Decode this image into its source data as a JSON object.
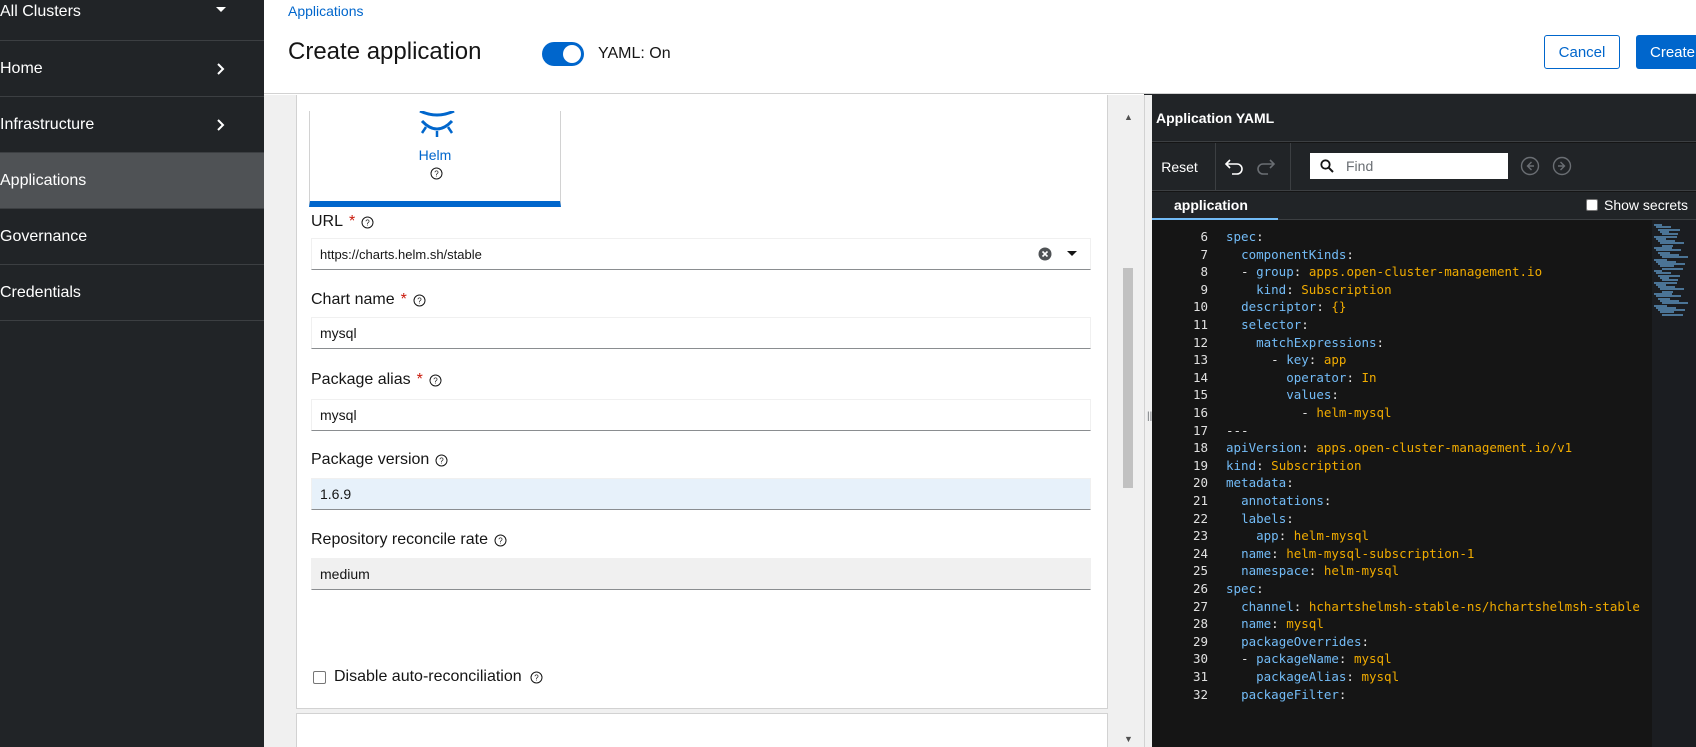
{
  "sidebar": {
    "items": [
      {
        "label": "All Clusters",
        "chevron": "down"
      },
      {
        "label": "Home",
        "chevron": "right"
      },
      {
        "label": "Infrastructure",
        "chevron": "right"
      },
      {
        "label": "Applications",
        "active": true
      },
      {
        "label": "Governance"
      },
      {
        "label": "Credentials"
      }
    ]
  },
  "header": {
    "breadcrumb": "Applications",
    "title": "Create application",
    "yaml_toggle_label": "YAML: On",
    "yaml_toggle_on": true,
    "cancel_label": "Cancel",
    "create_label": "Create"
  },
  "form": {
    "helm_tile_label": "Helm",
    "url": {
      "label": "URL",
      "required": "*",
      "value": "https://charts.helm.sh/stable"
    },
    "chart_name": {
      "label": "Chart name",
      "required": "*",
      "value": "mysql"
    },
    "package_alias": {
      "label": "Package alias",
      "required": "*",
      "value": "mysql"
    },
    "package_version": {
      "label": "Package version",
      "value": "1.6.9"
    },
    "reconcile_rate": {
      "label": "Repository reconcile rate",
      "value": "medium"
    },
    "disable_reconcile": {
      "label": "Disable auto-reconciliation",
      "checked": false
    }
  },
  "yaml": {
    "title": "Application YAML",
    "reset_label": "Reset",
    "find_placeholder": "Find",
    "tab_label": "application",
    "show_secrets_label": "Show secrets",
    "lines": [
      {
        "n": "6",
        "indent": "",
        "key": "spec",
        "sep": ":",
        "val": ""
      },
      {
        "n": "7",
        "indent": "  ",
        "key": "componentKinds",
        "sep": ":",
        "val": ""
      },
      {
        "n": "8",
        "indent": "  - ",
        "key": "group",
        "sep": ": ",
        "val": "apps.open-cluster-management.io"
      },
      {
        "n": "9",
        "indent": "    ",
        "key": "kind",
        "sep": ": ",
        "val": "Subscription"
      },
      {
        "n": "10",
        "indent": "  ",
        "key": "descriptor",
        "sep": ": ",
        "val": "{}"
      },
      {
        "n": "11",
        "indent": "  ",
        "key": "selector",
        "sep": ":",
        "val": ""
      },
      {
        "n": "12",
        "indent": "    ",
        "key": "matchExpressions",
        "sep": ":",
        "val": ""
      },
      {
        "n": "13",
        "indent": "      - ",
        "key": "key",
        "sep": ": ",
        "val": "app"
      },
      {
        "n": "14",
        "indent": "        ",
        "key": "operator",
        "sep": ": ",
        "val": "In"
      },
      {
        "n": "15",
        "indent": "        ",
        "key": "values",
        "sep": ":",
        "val": ""
      },
      {
        "n": "16",
        "indent": "          - ",
        "key": "",
        "sep": "",
        "val": "helm-mysql"
      },
      {
        "n": "17",
        "indent": "",
        "key": "",
        "sep": "---",
        "val": ""
      },
      {
        "n": "18",
        "indent": "",
        "key": "apiVersion",
        "sep": ": ",
        "val": "apps.open-cluster-management.io/v1"
      },
      {
        "n": "19",
        "indent": "",
        "key": "kind",
        "sep": ": ",
        "val": "Subscription"
      },
      {
        "n": "20",
        "indent": "",
        "key": "metadata",
        "sep": ":",
        "val": ""
      },
      {
        "n": "21",
        "indent": "  ",
        "key": "annotations",
        "sep": ":",
        "val": ""
      },
      {
        "n": "22",
        "indent": "  ",
        "key": "labels",
        "sep": ":",
        "val": ""
      },
      {
        "n": "23",
        "indent": "    ",
        "key": "app",
        "sep": ": ",
        "val": "helm-mysql"
      },
      {
        "n": "24",
        "indent": "  ",
        "key": "name",
        "sep": ": ",
        "val": "helm-mysql-subscription-1"
      },
      {
        "n": "25",
        "indent": "  ",
        "key": "namespace",
        "sep": ": ",
        "val": "helm-mysql"
      },
      {
        "n": "26",
        "indent": "",
        "key": "spec",
        "sep": ":",
        "val": ""
      },
      {
        "n": "27",
        "indent": "  ",
        "key": "channel",
        "sep": ": ",
        "val": "hchartshelmsh-stable-ns/hchartshelmsh-stable"
      },
      {
        "n": "28",
        "indent": "  ",
        "key": "name",
        "sep": ": ",
        "val": "mysql"
      },
      {
        "n": "29",
        "indent": "  ",
        "key": "packageOverrides",
        "sep": ":",
        "val": ""
      },
      {
        "n": "30",
        "indent": "  - ",
        "key": "packageName",
        "sep": ": ",
        "val": "mysql"
      },
      {
        "n": "31",
        "indent": "    ",
        "key": "packageAlias",
        "sep": ": ",
        "val": "mysql"
      },
      {
        "n": "32",
        "indent": "  ",
        "key": "packageFilter",
        "sep": ":",
        "val": ""
      }
    ]
  }
}
